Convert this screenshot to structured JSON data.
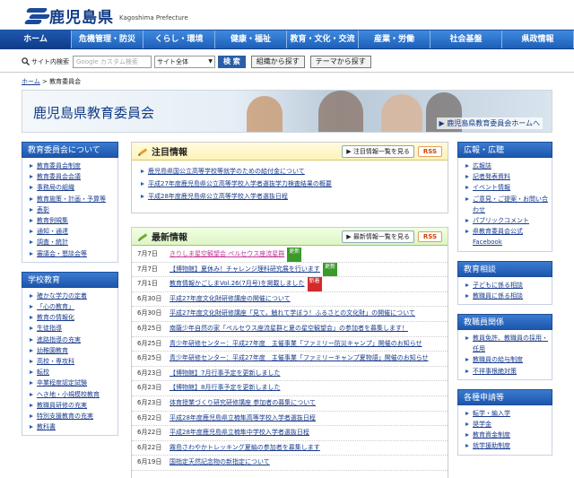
{
  "header": {
    "title": "鹿児島県",
    "subtitle": "Kagoshima Prefecture"
  },
  "nav": [
    "ホーム",
    "危機管理・防災",
    "くらし・環境",
    "健康・福祉",
    "教育・文化・交流",
    "産業・労働",
    "社会基盤",
    "県政情報"
  ],
  "search": {
    "label": "サイト内検索",
    "placeholder": "Google カスタム検索",
    "scope": "サイト全体",
    "button": "検 索",
    "tab1": "組織から探す",
    "tab2": "テーマから探す"
  },
  "breadcrumb": {
    "home": "ホーム",
    "sep": " > ",
    "current": "教育委員会"
  },
  "banner": {
    "title": "鹿児島県教育委員会",
    "link": "鹿児島県教育委員会ホームへ"
  },
  "left": {
    "sections": [
      {
        "title": "教育委員会について",
        "items": [
          "教育委員会制度",
          "教育委員会会議",
          "事務局の組織",
          "教育施策・計画・予算等",
          "表彰",
          "教育例規集",
          "通知・通達",
          "調査・統計",
          "審議会・懇談会等"
        ]
      },
      {
        "title": "学校教育",
        "items": [
          "確かな学力の定着",
          "「心の教育」",
          "教育の情報化",
          "生徒指導",
          "進路指導の充実",
          "幼稚園教育",
          "高校・専攻科",
          "転校",
          "卒業程度認定試験",
          "へき地・小規模校教育",
          "教職員研修の充実",
          "特別支援教育の充実",
          "教科書"
        ]
      }
    ]
  },
  "right": {
    "sections": [
      {
        "title": "広報・広聴",
        "items": [
          "広報誌",
          "記者発表資料",
          "イベント情報",
          "ご意見・ご提案・お問い合わせ",
          "パブリックコメント",
          "県教育委員会公式Facebook"
        ]
      },
      {
        "title": "教育相談",
        "items": [
          "子どもに係る相談",
          "教職員に係る相談"
        ]
      },
      {
        "title": "教職員関係",
        "items": [
          "教員免許、教職員の採用・任用",
          "教職員の給与制度",
          "不祥事根絶対策"
        ]
      },
      {
        "title": "各種申請等",
        "items": [
          "転学・編入学",
          "奨学金",
          "教育資金制度",
          "就学援助制度"
        ]
      }
    ]
  },
  "notice": {
    "title": "注目情報",
    "more": "注目情報一覧を見る",
    "rss": "RSS",
    "items": [
      "鹿児島県国公立高等学校等就学のための給付金について",
      "平成27年度鹿児島県公立高等学校入学者選抜学力検査結果の概要",
      "平成28年度鹿児島県公立高等学校入学者選抜日程"
    ]
  },
  "latest": {
    "title": "最新情報",
    "more": "最新情報一覧を見る",
    "rss": "RSS",
    "items": [
      {
        "date": "7月7日",
        "text": "きりしま星空観望会 ペルセウス座流星群",
        "tag": "更新",
        "tagc": "g",
        "pink": true
      },
      {
        "date": "7月7日",
        "text": "【博物館】夏休み！チャレンジ理科研究展を行います",
        "tag": "更新",
        "tagc": "g"
      },
      {
        "date": "7月1日",
        "text": "教育情報かごしまVol.26(7月号)を掲載しました",
        "tag": "新着",
        "tagc": "r"
      },
      {
        "date": "6月30日",
        "text": "平成27年度文化財研修講座の開催について"
      },
      {
        "date": "6月30日",
        "text": "平成27年度文化財研修講座「見て，触れて学ぼう！ふるさとの文化財」の開催について"
      },
      {
        "date": "6月25日",
        "text": "南薩少年自然の家「ペルセウス座流星群と夏の星空観望会」の参加者を募集します！"
      },
      {
        "date": "6月25日",
        "text": "青少年研修センター：平成27年度　主催事業「ファミリー防災キャンプ」開催のお知らせ"
      },
      {
        "date": "6月25日",
        "text": "青少年研修センター：平成27年度　主催事業「ファミリーキャンプ夏物語」開催のお知らせ"
      },
      {
        "date": "6月23日",
        "text": "【博物館】7月行事予定を更新しました"
      },
      {
        "date": "6月23日",
        "text": "【博物館】8月行事予定を更新しました"
      },
      {
        "date": "6月23日",
        "text": "体育授業づくり研究研修講座 参加者の募集について"
      },
      {
        "date": "6月22日",
        "text": "平成28年度鹿児島県立楠隼高等学校入学者選抜日程"
      },
      {
        "date": "6月22日",
        "text": "平成28年度鹿児島県立楠隼中学校入学者選抜日程"
      },
      {
        "date": "6月22日",
        "text": "霧島さわやかトレッキング夏編の参加者を募集します"
      },
      {
        "date": "6月19日",
        "text": "国指定天然記念物の新指定について"
      }
    ]
  }
}
